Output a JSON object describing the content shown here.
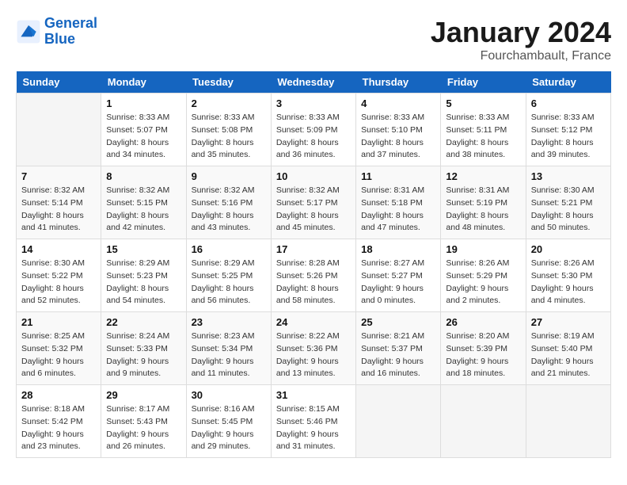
{
  "logo": {
    "line1": "General",
    "line2": "Blue"
  },
  "title": "January 2024",
  "location": "Fourchambault, France",
  "days_header": [
    "Sunday",
    "Monday",
    "Tuesday",
    "Wednesday",
    "Thursday",
    "Friday",
    "Saturday"
  ],
  "weeks": [
    [
      {
        "num": "",
        "sunrise": "",
        "sunset": "",
        "daylight": ""
      },
      {
        "num": "1",
        "sunrise": "Sunrise: 8:33 AM",
        "sunset": "Sunset: 5:07 PM",
        "daylight": "Daylight: 8 hours and 34 minutes."
      },
      {
        "num": "2",
        "sunrise": "Sunrise: 8:33 AM",
        "sunset": "Sunset: 5:08 PM",
        "daylight": "Daylight: 8 hours and 35 minutes."
      },
      {
        "num": "3",
        "sunrise": "Sunrise: 8:33 AM",
        "sunset": "Sunset: 5:09 PM",
        "daylight": "Daylight: 8 hours and 36 minutes."
      },
      {
        "num": "4",
        "sunrise": "Sunrise: 8:33 AM",
        "sunset": "Sunset: 5:10 PM",
        "daylight": "Daylight: 8 hours and 37 minutes."
      },
      {
        "num": "5",
        "sunrise": "Sunrise: 8:33 AM",
        "sunset": "Sunset: 5:11 PM",
        "daylight": "Daylight: 8 hours and 38 minutes."
      },
      {
        "num": "6",
        "sunrise": "Sunrise: 8:33 AM",
        "sunset": "Sunset: 5:12 PM",
        "daylight": "Daylight: 8 hours and 39 minutes."
      }
    ],
    [
      {
        "num": "7",
        "sunrise": "Sunrise: 8:32 AM",
        "sunset": "Sunset: 5:14 PM",
        "daylight": "Daylight: 8 hours and 41 minutes."
      },
      {
        "num": "8",
        "sunrise": "Sunrise: 8:32 AM",
        "sunset": "Sunset: 5:15 PM",
        "daylight": "Daylight: 8 hours and 42 minutes."
      },
      {
        "num": "9",
        "sunrise": "Sunrise: 8:32 AM",
        "sunset": "Sunset: 5:16 PM",
        "daylight": "Daylight: 8 hours and 43 minutes."
      },
      {
        "num": "10",
        "sunrise": "Sunrise: 8:32 AM",
        "sunset": "Sunset: 5:17 PM",
        "daylight": "Daylight: 8 hours and 45 minutes."
      },
      {
        "num": "11",
        "sunrise": "Sunrise: 8:31 AM",
        "sunset": "Sunset: 5:18 PM",
        "daylight": "Daylight: 8 hours and 47 minutes."
      },
      {
        "num": "12",
        "sunrise": "Sunrise: 8:31 AM",
        "sunset": "Sunset: 5:19 PM",
        "daylight": "Daylight: 8 hours and 48 minutes."
      },
      {
        "num": "13",
        "sunrise": "Sunrise: 8:30 AM",
        "sunset": "Sunset: 5:21 PM",
        "daylight": "Daylight: 8 hours and 50 minutes."
      }
    ],
    [
      {
        "num": "14",
        "sunrise": "Sunrise: 8:30 AM",
        "sunset": "Sunset: 5:22 PM",
        "daylight": "Daylight: 8 hours and 52 minutes."
      },
      {
        "num": "15",
        "sunrise": "Sunrise: 8:29 AM",
        "sunset": "Sunset: 5:23 PM",
        "daylight": "Daylight: 8 hours and 54 minutes."
      },
      {
        "num": "16",
        "sunrise": "Sunrise: 8:29 AM",
        "sunset": "Sunset: 5:25 PM",
        "daylight": "Daylight: 8 hours and 56 minutes."
      },
      {
        "num": "17",
        "sunrise": "Sunrise: 8:28 AM",
        "sunset": "Sunset: 5:26 PM",
        "daylight": "Daylight: 8 hours and 58 minutes."
      },
      {
        "num": "18",
        "sunrise": "Sunrise: 8:27 AM",
        "sunset": "Sunset: 5:27 PM",
        "daylight": "Daylight: 9 hours and 0 minutes."
      },
      {
        "num": "19",
        "sunrise": "Sunrise: 8:26 AM",
        "sunset": "Sunset: 5:29 PM",
        "daylight": "Daylight: 9 hours and 2 minutes."
      },
      {
        "num": "20",
        "sunrise": "Sunrise: 8:26 AM",
        "sunset": "Sunset: 5:30 PM",
        "daylight": "Daylight: 9 hours and 4 minutes."
      }
    ],
    [
      {
        "num": "21",
        "sunrise": "Sunrise: 8:25 AM",
        "sunset": "Sunset: 5:32 PM",
        "daylight": "Daylight: 9 hours and 6 minutes."
      },
      {
        "num": "22",
        "sunrise": "Sunrise: 8:24 AM",
        "sunset": "Sunset: 5:33 PM",
        "daylight": "Daylight: 9 hours and 9 minutes."
      },
      {
        "num": "23",
        "sunrise": "Sunrise: 8:23 AM",
        "sunset": "Sunset: 5:34 PM",
        "daylight": "Daylight: 9 hours and 11 minutes."
      },
      {
        "num": "24",
        "sunrise": "Sunrise: 8:22 AM",
        "sunset": "Sunset: 5:36 PM",
        "daylight": "Daylight: 9 hours and 13 minutes."
      },
      {
        "num": "25",
        "sunrise": "Sunrise: 8:21 AM",
        "sunset": "Sunset: 5:37 PM",
        "daylight": "Daylight: 9 hours and 16 minutes."
      },
      {
        "num": "26",
        "sunrise": "Sunrise: 8:20 AM",
        "sunset": "Sunset: 5:39 PM",
        "daylight": "Daylight: 9 hours and 18 minutes."
      },
      {
        "num": "27",
        "sunrise": "Sunrise: 8:19 AM",
        "sunset": "Sunset: 5:40 PM",
        "daylight": "Daylight: 9 hours and 21 minutes."
      }
    ],
    [
      {
        "num": "28",
        "sunrise": "Sunrise: 8:18 AM",
        "sunset": "Sunset: 5:42 PM",
        "daylight": "Daylight: 9 hours and 23 minutes."
      },
      {
        "num": "29",
        "sunrise": "Sunrise: 8:17 AM",
        "sunset": "Sunset: 5:43 PM",
        "daylight": "Daylight: 9 hours and 26 minutes."
      },
      {
        "num": "30",
        "sunrise": "Sunrise: 8:16 AM",
        "sunset": "Sunset: 5:45 PM",
        "daylight": "Daylight: 9 hours and 29 minutes."
      },
      {
        "num": "31",
        "sunrise": "Sunrise: 8:15 AM",
        "sunset": "Sunset: 5:46 PM",
        "daylight": "Daylight: 9 hours and 31 minutes."
      },
      {
        "num": "",
        "sunrise": "",
        "sunset": "",
        "daylight": ""
      },
      {
        "num": "",
        "sunrise": "",
        "sunset": "",
        "daylight": ""
      },
      {
        "num": "",
        "sunrise": "",
        "sunset": "",
        "daylight": ""
      }
    ]
  ]
}
